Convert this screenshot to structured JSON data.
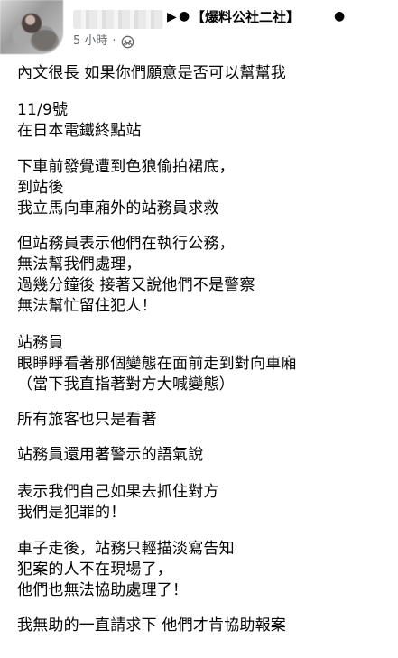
{
  "header": {
    "separator_triangle": "▶",
    "dot_before_group": "●",
    "group_name": "【爆料公社二社】",
    "dot_after_group": "●",
    "time": "5 小時",
    "meta_separator": "·",
    "privacy_icon": "group-icon"
  },
  "post": {
    "paragraphs": [
      [
        "內文很長  如果你們願意是否可以幫幫我"
      ],
      [
        "11/9號",
        "在日本電鐵終點站"
      ],
      [
        "下車前發覺遭到色狼偷拍裙底，",
        "到站後",
        "我立馬向車廂外的站務員求救"
      ],
      [
        "但站務員表示他們在執行公務，",
        "無法幫我們處理，",
        "過幾分鐘後 接著又說他們不是警察",
        "無法幫忙留住犯人！"
      ],
      [
        "站務員",
        "眼睜睜看著那個變態在面前走到對向車廂",
        "（當下我直指著對方大喊變態）"
      ],
      [
        "所有旅客也只是看著"
      ],
      [
        "站務員還用著警示的語氣說"
      ],
      [
        "表示我們自己如果去抓住對方",
        "我們是犯罪的！"
      ],
      [
        "車子走後，站務只輕描淡寫告知",
        "犯案的人不在現場了，",
        "他們也無法協助處理了！"
      ],
      [
        "我無助的一直請求下 他們才肯協助報案"
      ]
    ]
  }
}
